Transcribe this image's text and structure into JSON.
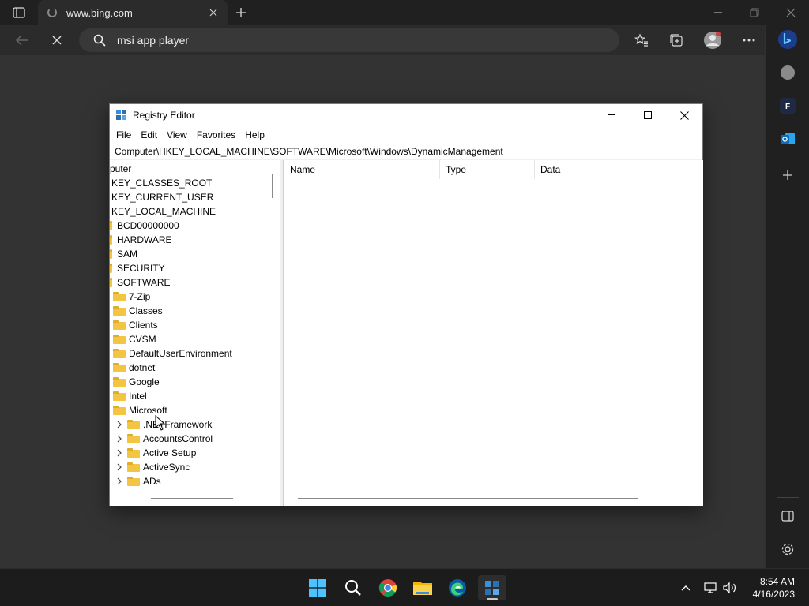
{
  "browser": {
    "tab_title": "www.bing.com",
    "address_text": "msi app player"
  },
  "registry_editor": {
    "title": "Registry Editor",
    "menu": [
      "File",
      "Edit",
      "View",
      "Favorites",
      "Help"
    ],
    "address": "Computer\\HKEY_LOCAL_MACHINE\\SOFTWARE\\Microsoft\\Windows\\DynamicManagement",
    "tree": {
      "root": "puter",
      "hives": [
        "KEY_CLASSES_ROOT",
        "KEY_CURRENT_USER",
        "KEY_LOCAL_MACHINE"
      ],
      "hklm_children": [
        "BCD00000000",
        "HARDWARE",
        "SAM",
        "SECURITY",
        "SOFTWARE"
      ],
      "software_children": [
        "7-Zip",
        "Classes",
        "Clients",
        "CVSM",
        "DefaultUserEnvironment",
        "dotnet",
        "Google",
        "Intel",
        "Microsoft"
      ],
      "microsoft_children": [
        ".NETFramework",
        "AccountsControl",
        "Active Setup",
        "ActiveSync",
        "ADs"
      ]
    },
    "columns": [
      "Name",
      "Type",
      "Data"
    ]
  },
  "sidebar": {
    "outlook_letter": "F"
  },
  "taskbar": {
    "time": "8:54 AM",
    "date": "4/16/2023"
  },
  "colors": {
    "folder": "#f4c542",
    "browser_bg": "#202020",
    "page_bg": "#333333",
    "accent": "#0078d4"
  }
}
